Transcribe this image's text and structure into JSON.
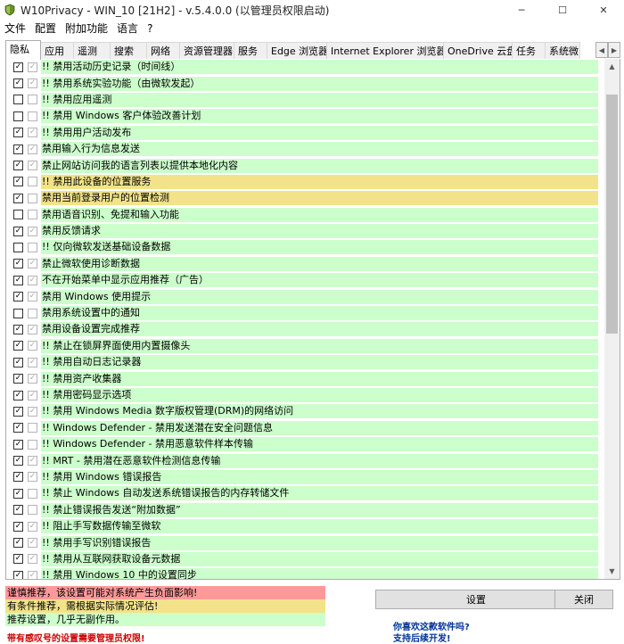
{
  "window": {
    "title": "W10Privacy - WIN_10 [21H2] - v.5.4.0.0 (以管理员权限启动)",
    "minimize": "─",
    "maximize": "☐",
    "close": "✕",
    "app_icon": "shield-icon"
  },
  "menu": [
    "文件",
    "配置",
    "附加功能",
    "语言",
    "?"
  ],
  "tabs": [
    "隐私",
    "应用",
    "遥测",
    "搜索",
    "网络",
    "资源管理器",
    "服务",
    "Edge 浏览器",
    "Internet Explorer 浏览器",
    "OneDrive 云盘",
    "任务",
    "系统微"
  ],
  "tab_scroll": {
    "left": "◀",
    "right": "▶"
  },
  "settings": [
    {
      "label": "!! 禁用活动历史记录（时间线）",
      "checked": true,
      "sub": true,
      "color": "green"
    },
    {
      "label": "!! 禁用系统实验功能（由微软发起）",
      "checked": true,
      "sub": true,
      "color": "green"
    },
    {
      "label": "!! 禁用应用遥测",
      "checked": false,
      "sub": false,
      "color": "green"
    },
    {
      "label": "!! 禁用 Windows 客户体验改善计划",
      "checked": false,
      "sub": false,
      "color": "green"
    },
    {
      "label": "!! 禁用用户活动发布",
      "checked": true,
      "sub": true,
      "color": "green"
    },
    {
      "label": "禁用输入行为信息发送",
      "checked": true,
      "sub": true,
      "color": "green"
    },
    {
      "label": "禁止网站访问我的语言列表以提供本地化内容",
      "checked": true,
      "sub": true,
      "color": "green"
    },
    {
      "label": "!! 禁用此设备的位置服务",
      "checked": true,
      "sub": false,
      "color": "yellow"
    },
    {
      "label": "禁用当前登录用户的位置检测",
      "checked": true,
      "sub": false,
      "color": "yellow"
    },
    {
      "label": "禁用语音识别、免提和输入功能",
      "checked": false,
      "sub": false,
      "color": "green"
    },
    {
      "label": "禁用反馈请求",
      "checked": true,
      "sub": true,
      "color": "green"
    },
    {
      "label": "!! 仅向微软发送基础设备数据",
      "checked": false,
      "sub": false,
      "color": "green"
    },
    {
      "label": "禁止微软使用诊断数据",
      "checked": true,
      "sub": true,
      "color": "green"
    },
    {
      "label": "不在开始菜单中显示应用推荐（广告）",
      "checked": true,
      "sub": true,
      "color": "green"
    },
    {
      "label": "禁用 Windows 使用提示",
      "checked": true,
      "sub": true,
      "color": "green"
    },
    {
      "label": "禁用系统设置中的通知",
      "checked": false,
      "sub": false,
      "color": "green"
    },
    {
      "label": "禁用设备设置完成推荐",
      "checked": true,
      "sub": true,
      "color": "green"
    },
    {
      "label": "!! 禁止在锁屏界面使用内置摄像头",
      "checked": true,
      "sub": true,
      "color": "green"
    },
    {
      "label": "!! 禁用自动日志记录器",
      "checked": true,
      "sub": true,
      "color": "green"
    },
    {
      "label": "!! 禁用资产收集器",
      "checked": true,
      "sub": true,
      "color": "green"
    },
    {
      "label": "!! 禁用密码显示选项",
      "checked": true,
      "sub": true,
      "color": "green"
    },
    {
      "label": "!! 禁用 Windows Media 数字版权管理(DRM)的网络访问",
      "checked": true,
      "sub": true,
      "color": "green"
    },
    {
      "label": "!! Windows Defender - 禁用发送潜在安全问题信息",
      "checked": true,
      "sub": false,
      "color": "green"
    },
    {
      "label": "!! Windows Defender - 禁用恶意软件样本传输",
      "checked": true,
      "sub": false,
      "color": "green"
    },
    {
      "label": "!! MRT - 禁用潜在恶意软件检测信息传输",
      "checked": true,
      "sub": true,
      "color": "green"
    },
    {
      "label": "!! 禁用 Windows 错误报告",
      "checked": true,
      "sub": true,
      "color": "green"
    },
    {
      "label": "!! 禁止 Windows 自动发送系统错误报告的内存转储文件",
      "checked": true,
      "sub": false,
      "color": "green"
    },
    {
      "label": "!! 禁止错误报告发送“附加数据”",
      "checked": true,
      "sub": false,
      "color": "green"
    },
    {
      "label": "!! 阻止手写数据传输至微软",
      "checked": true,
      "sub": true,
      "color": "green"
    },
    {
      "label": "!! 禁用手写识别错误报告",
      "checked": true,
      "sub": true,
      "color": "green"
    },
    {
      "label": "!! 禁用从互联网获取设备元数据",
      "checked": true,
      "sub": true,
      "color": "green"
    },
    {
      "label": "!! 禁用 Windows 10 中的设置同步",
      "checked": true,
      "sub": true,
      "color": "green"
    }
  ],
  "legend": {
    "red": "谨慎推荐，该设置可能对系统产生负面影响!",
    "yellow": "有条件推荐，需根据实际情况评估!",
    "green": "推荐设置，几乎无副作用。"
  },
  "admin_note": "带有感叹号的设置需要管理员权限!",
  "buttons": {
    "apply": "设置",
    "close": "关闭"
  },
  "promo": {
    "line1": "你喜欢这款软件吗?",
    "line2": "支持后续开发!"
  },
  "colors": {
    "green": "#ccffcc",
    "yellow": "#f2e38a",
    "red": "#ff9999",
    "admin_note": "#cc0000",
    "promo": "#003399"
  },
  "scrollbar": {
    "up": "▲",
    "down": "▼"
  }
}
